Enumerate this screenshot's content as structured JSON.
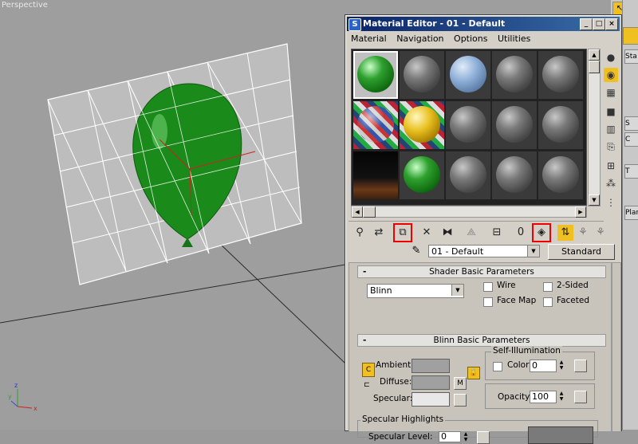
{
  "viewport": {
    "label": "Perspective"
  },
  "window": {
    "title": "Material Editor - 01 - Default",
    "min_glyph": "_",
    "max_glyph": "□",
    "close_glyph": "×"
  },
  "menu": {
    "items": [
      {
        "label": "Material"
      },
      {
        "label": "Navigation"
      },
      {
        "label": "Options"
      },
      {
        "label": "Utilities"
      }
    ]
  },
  "material": {
    "name": "01 - Default",
    "type_button": "Standard"
  },
  "shader_rollout": {
    "title": "Shader Basic Parameters",
    "shader": "Blinn",
    "wire": "Wire",
    "two_sided": "2-Sided",
    "face_map": "Face Map",
    "faceted": "Faceted"
  },
  "blinn_rollout": {
    "title": "Blinn Basic Parameters",
    "ambient": "Ambient:",
    "diffuse": "Diffuse:",
    "specular": "Specular:",
    "map_btn": "M",
    "self_illum_title": "Self-Illumination",
    "color_label": "Color",
    "color_value": "0",
    "opacity_label": "Opacity:",
    "opacity_value": "100"
  },
  "specular_highlights": {
    "title": "Specular Highlights",
    "level_label": "Specular Level:",
    "level_value": "0"
  },
  "command_panel": {
    "items": [
      "Sta",
      "S",
      "C",
      "T",
      "Plan"
    ]
  },
  "colors": {
    "title_bar": "#0a246a",
    "highlight_outline": "#e00000",
    "active_tool": "#f0c020",
    "balloon": "#1a8a1a"
  }
}
